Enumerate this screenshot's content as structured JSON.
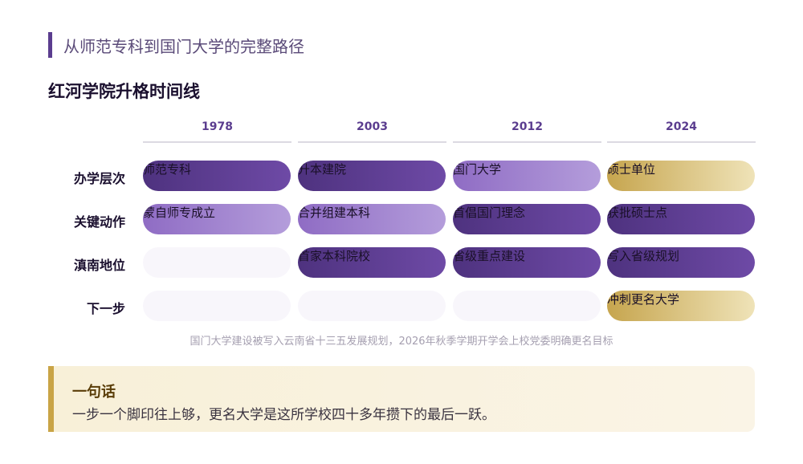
{
  "header": {
    "subtitle": "从师范专科到国门大学的完整路径",
    "title": "红河学院升格时间线"
  },
  "timeline": {
    "years": [
      "1978",
      "2003",
      "2012",
      "2024"
    ],
    "rows": [
      {
        "label": "办学层次",
        "cells": [
          {
            "text": "师范专科",
            "style": "dark"
          },
          {
            "text": "升本建院",
            "style": "dark"
          },
          {
            "text": "国门大学",
            "style": "light"
          },
          {
            "text": "硕士单位",
            "style": "gold"
          }
        ]
      },
      {
        "label": "关键动作",
        "cells": [
          {
            "text": "蒙自师专成立",
            "style": "light"
          },
          {
            "text": "合并组建本科",
            "style": "light"
          },
          {
            "text": "首倡国门理念",
            "style": "dark"
          },
          {
            "text": "获批硕士点",
            "style": "dark"
          }
        ]
      },
      {
        "label": "滇南地位",
        "cells": [
          {
            "text": "",
            "style": "empty"
          },
          {
            "text": "首家本科院校",
            "style": "dark"
          },
          {
            "text": "省级重点建设",
            "style": "dark"
          },
          {
            "text": "写入省级规划",
            "style": "dark"
          }
        ]
      },
      {
        "label": "下一步",
        "cells": [
          {
            "text": "",
            "style": "empty"
          },
          {
            "text": "",
            "style": "empty"
          },
          {
            "text": "",
            "style": "empty"
          },
          {
            "text": "冲刺更名大学",
            "style": "gold"
          }
        ]
      }
    ],
    "note": "国门大学建设被写入云南省十三五发展规划，2026年秋季学期开学会上校党委明确更名目标"
  },
  "callout": {
    "title": "一句话",
    "text": "一步一个脚印往上够，更名大学是这所学校四十多年攒下的最后一跃。"
  },
  "colors": {
    "accent": "#5b3d8f",
    "dark": "#4e327f",
    "light": "#b49ddb",
    "gold": "#c6a54e"
  }
}
